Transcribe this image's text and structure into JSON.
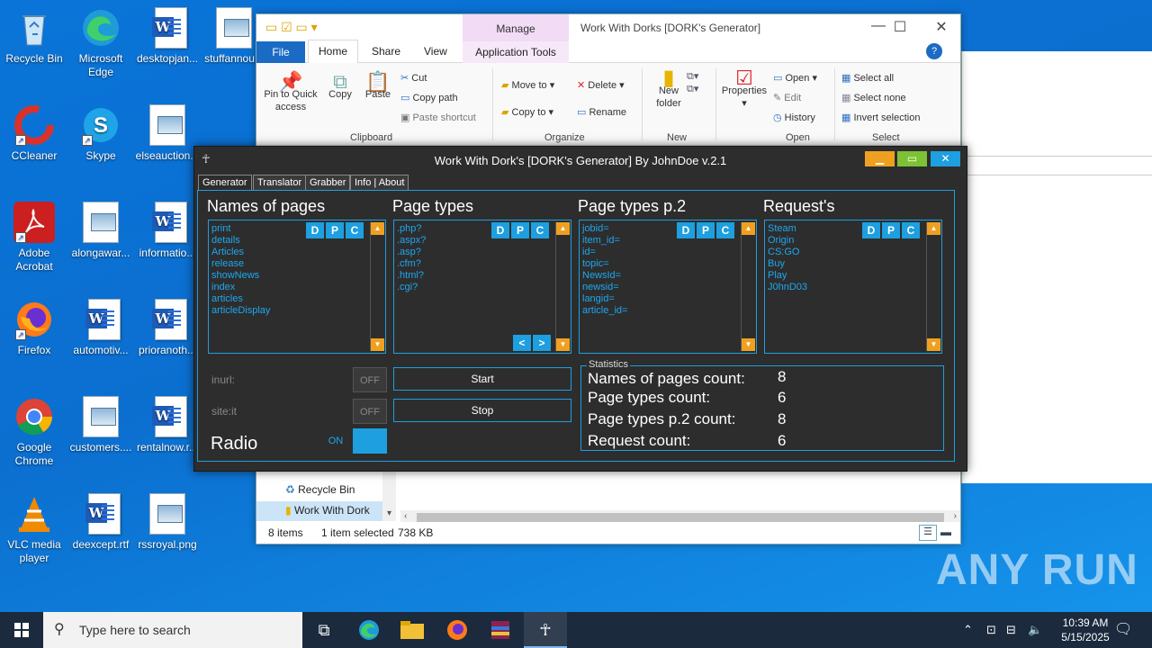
{
  "desktop": {
    "icons": [
      {
        "label": "Recycle Bin",
        "icon": "recycle-bin-icon"
      },
      {
        "label": "Microsoft Edge",
        "icon": "edge-icon"
      },
      {
        "label": "desktopjan...",
        "icon": "word-doc-icon"
      },
      {
        "label": "stuffannou...",
        "icon": "image-file-icon"
      },
      {
        "label": "CCleaner",
        "icon": "ccleaner-icon"
      },
      {
        "label": "Skype",
        "icon": "skype-icon"
      },
      {
        "label": "elseauction...",
        "icon": "image-file-icon"
      },
      {
        "label": "Adobe Acrobat",
        "icon": "acrobat-icon"
      },
      {
        "label": "alongawar...",
        "icon": "image-file-icon"
      },
      {
        "label": "informatio...",
        "icon": "word-doc-icon"
      },
      {
        "label": "Firefox",
        "icon": "firefox-icon"
      },
      {
        "label": "automotiv...",
        "icon": "word-doc-icon"
      },
      {
        "label": "prioranoth...",
        "icon": "word-doc-icon"
      },
      {
        "label": "Google Chrome",
        "icon": "chrome-icon"
      },
      {
        "label": "customers....",
        "icon": "image-file-icon"
      },
      {
        "label": "rentalnow.r...",
        "icon": "word-doc-icon"
      },
      {
        "label": "VLC media player",
        "icon": "vlc-icon"
      },
      {
        "label": "deexcept.rtf",
        "icon": "word-doc-icon"
      },
      {
        "label": "rssroyal.png",
        "icon": "image-file-icon"
      }
    ]
  },
  "explorer": {
    "title": "Work With Dorks [DORK's Generator]",
    "manage": "Manage",
    "tabs": {
      "file": "File",
      "home": "Home",
      "share": "Share",
      "view": "View",
      "app_tools": "Application Tools"
    },
    "ribbon": {
      "pin": "Pin to Quick access",
      "copy": "Copy",
      "paste": "Paste",
      "cut": "Cut",
      "copy_path": "Copy path",
      "paste_shortcut": "Paste shortcut",
      "clipboard": "Clipboard",
      "move_to": "Move to",
      "copy_to": "Copy to",
      "delete": "Delete",
      "rename": "Rename",
      "organize": "Organize",
      "new_folder": "New folder",
      "new": "New",
      "properties": "Properties",
      "open": "Open",
      "edit": "Edit",
      "history": "History",
      "open_group": "Open",
      "select_all": "Select all",
      "select_none": "Select none",
      "invert_selection": "Invert selection",
      "select": "Select"
    },
    "nav": {
      "recycle_bin": "Recycle Bin",
      "work_with_dork": "Work With Dork"
    },
    "status": {
      "items": "8 items",
      "selected": "1 item selected",
      "size": "738 KB"
    }
  },
  "dork": {
    "title": "Work With Dork's [DORK's Generator] By JohnDoe v.2.1",
    "tabs": [
      "Generator",
      "Translator",
      "Grabber",
      "Info | About"
    ],
    "columns": [
      {
        "title": "Names of pages",
        "items": [
          "print",
          "details",
          "Articles",
          "release",
          "showNews",
          "index",
          "articles",
          "articleDisplay"
        ]
      },
      {
        "title": "Page types",
        "items": [
          ".php?",
          ".aspx?",
          ".asp?",
          ".cfm?",
          ".html?",
          ".cgi?"
        ]
      },
      {
        "title": "Page types p.2",
        "items": [
          "jobid=",
          "item_id=",
          "id=",
          "topic=",
          "NewsId=",
          "newsid=",
          "langid=",
          "article_id="
        ]
      },
      {
        "title": "Request's",
        "items": [
          "Steam",
          "Origin",
          "CS:GO",
          "Buy",
          "Play",
          "J0hnD03"
        ]
      }
    ],
    "buttons": {
      "d": "D",
      "p": "P",
      "c": "C",
      "prev": "<",
      "next": ">",
      "start": "Start",
      "stop": "Stop"
    },
    "inputs": {
      "inurl": "inurl:",
      "site": "site:it"
    },
    "toggles": {
      "off": "OFF",
      "on": "ON"
    },
    "radio_label": "Radio",
    "stats": {
      "legend": "Statistics",
      "rows": [
        {
          "label": "Names of pages count:",
          "value": "8"
        },
        {
          "label": "Page types count:",
          "value": "6"
        },
        {
          "label": "Page types p.2 count:",
          "value": "8"
        },
        {
          "label": "Request count:",
          "value": "6"
        }
      ]
    }
  },
  "taskbar": {
    "search_placeholder": "Type here to search",
    "time": "10:39 AM",
    "date": "5/15/2025"
  },
  "watermark": "ANY RUN"
}
